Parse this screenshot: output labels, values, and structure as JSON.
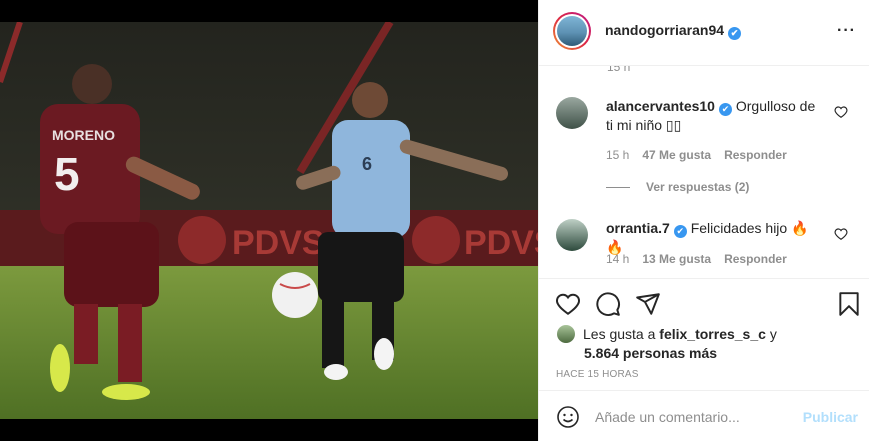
{
  "header": {
    "username": "nandogorriaran94",
    "verified_mark": "✔",
    "more_icon": "···"
  },
  "comments_panel": {
    "partial_timestamp": "15 h",
    "comments": [
      {
        "username": "alancervantes10",
        "verified_mark": "✔",
        "text": "Orgulloso de ti mi niño ▯▯",
        "time": "15 h",
        "likes": "47 Me gusta",
        "reply": "Responder"
      },
      {
        "username": "orrantia.7",
        "verified_mark": "✔",
        "text": "Felicidades hijo 🔥🔥",
        "time": "14 h",
        "likes": "13 Me gusta",
        "reply": "Responder"
      }
    ],
    "view_replies": "Ver respuestas (2)"
  },
  "actions": {
    "icons": [
      "heart-icon",
      "comment-icon",
      "share-icon",
      "bookmark-icon"
    ],
    "likes_prefix": "Les gusta a",
    "likes_user": "felix_torres_s_c",
    "likes_conj": "y",
    "likes_count": "5.864 personas más",
    "time_ago": "HACE 15 HORAS"
  },
  "add_comment": {
    "placeholder": "Añade un comentario...",
    "publish": "Publicar"
  },
  "photo": {
    "player_left_name": "MORENO",
    "player_left_number": "5",
    "player_right_number": "6",
    "ad_text": "PDVS"
  },
  "colors": {
    "verified": "#3897f0",
    "publish_disabled": "#b2dffc",
    "meta_text": "#8e8e8e",
    "venezuela_kit": "#6b1a22",
    "uruguay_kit": "#8fb6dc"
  }
}
